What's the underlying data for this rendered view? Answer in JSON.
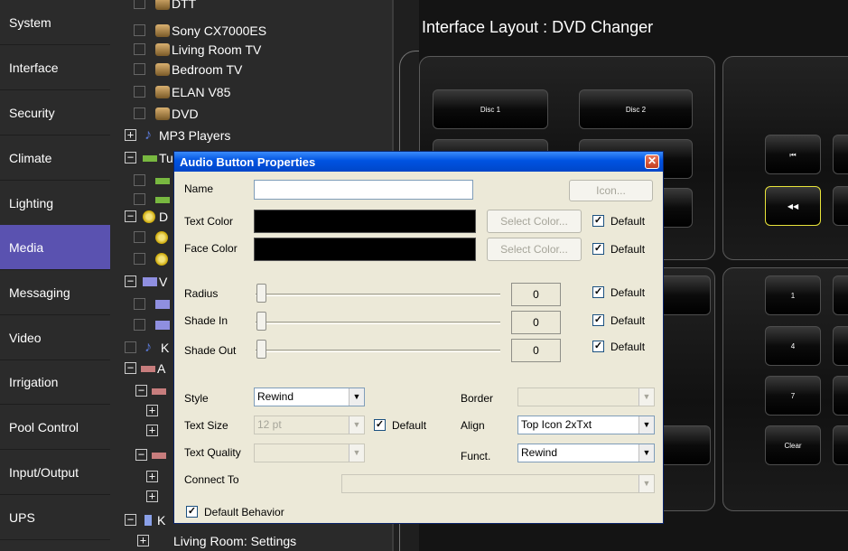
{
  "nav": {
    "items": [
      "System",
      "Interface",
      "Security",
      "Climate",
      "Lighting",
      "Media",
      "Messaging",
      "Video",
      "Irrigation",
      "Pool Control",
      "Input/Output",
      "UPS"
    ],
    "active": "Media"
  },
  "tree": {
    "rows": {
      "dtv": "DTT",
      "sony": "Sony CX7000ES",
      "living_tv": "Living Room TV",
      "bedroom_tv": "Bedroom TV",
      "elan": "ELAN V85",
      "dvd": "DVD",
      "mp3": "MP3 Players",
      "tuners": "Tu",
      "dvd_group": "D",
      "video_group": "V",
      "keypad_k": "K",
      "audio_group": "A",
      "keypad_k2": "K",
      "living_settings": "Living Room: Settings"
    }
  },
  "layout": {
    "title": "Interface Layout : DVD Changer",
    "buttons": {
      "disc1": "Disc 1",
      "disc2": "Disc 2",
      "prev": "⏮",
      "rewind": "◀◀",
      "num1": "1",
      "num4": "4",
      "num7": "7",
      "clear": "Clear"
    }
  },
  "dialog": {
    "title": "Audio Button Properties",
    "close": "✕",
    "name_label": "Name",
    "name_value": "",
    "icon_button": "Icon...",
    "text_color_label": "Text Color",
    "face_color_label": "Face Color",
    "select_color": "Select Color...",
    "default_label": "Default",
    "radius_label": "Radius",
    "radius_value": "0",
    "shade_in_label": "Shade In",
    "shade_in_value": "0",
    "shade_out_label": "Shade Out",
    "shade_out_value": "0",
    "style_label": "Style",
    "style_value": "Rewind",
    "border_label": "Border",
    "border_value": "",
    "text_size_label": "Text Size",
    "text_size_value": "12 pt",
    "align_label": "Align",
    "align_value": "Top Icon 2xTxt",
    "text_quality_label": "Text Quality",
    "text_quality_value": "",
    "funct_label": "Funct.",
    "funct_value": "Rewind",
    "connect_label": "Connect To",
    "connect_value": "",
    "default_behavior_label": "Default Behavior",
    "check_mark": "✓"
  }
}
